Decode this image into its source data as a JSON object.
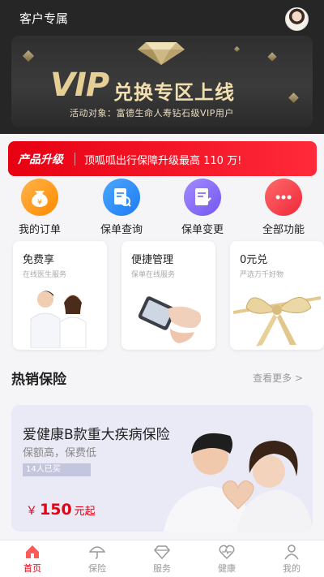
{
  "header": {
    "title": "客户专属"
  },
  "banner": {
    "title_vip": "VIP",
    "title_rest": "兑换专区上线",
    "subtitle": "活动对象：富德生命人寿钻石级VIP用户"
  },
  "promo": {
    "tag": "产品升级",
    "text": "顶呱呱出行保障升级最高 110 万!",
    "color": "#e60012"
  },
  "quick_actions": [
    {
      "label": "我的订单",
      "icon": "money-bag-icon",
      "color": "#ff9a1f"
    },
    {
      "label": "保单查询",
      "icon": "document-search-icon",
      "color": "#2d8cff"
    },
    {
      "label": "保单变更",
      "icon": "document-edit-icon",
      "color": "#8a6cff"
    },
    {
      "label": "全部功能",
      "icon": "more-dots-icon",
      "color": "#ff4040"
    }
  ],
  "cards": [
    {
      "title": "免费享",
      "subtitle": "在线医生服务",
      "icon": "doctors-image"
    },
    {
      "title": "便捷管理",
      "subtitle": "保单在线服务",
      "icon": "phone-hand-image"
    },
    {
      "title": "0元兑",
      "subtitle": "严选万千好物",
      "icon": "gift-bow-image"
    }
  ],
  "hot": {
    "title": "热销保险",
    "more": "查看更多 >"
  },
  "product": {
    "name": "爱健康B款重大疾病保险",
    "desc": "保额高，保费低",
    "buyers": "14人已买",
    "currency": "￥",
    "price": "150",
    "price_suffix": "元起"
  },
  "tabbar": [
    {
      "label": "首页",
      "icon": "home-icon",
      "active": true
    },
    {
      "label": "保险",
      "icon": "umbrella-icon",
      "active": false
    },
    {
      "label": "服务",
      "icon": "diamond-icon",
      "active": false
    },
    {
      "label": "健康",
      "icon": "heart-pulse-icon",
      "active": false
    },
    {
      "label": "我的",
      "icon": "user-icon",
      "active": false
    }
  ],
  "colors": {
    "accent": "#e60012",
    "header_bg": "#262626",
    "gold": "#e6cf95"
  }
}
